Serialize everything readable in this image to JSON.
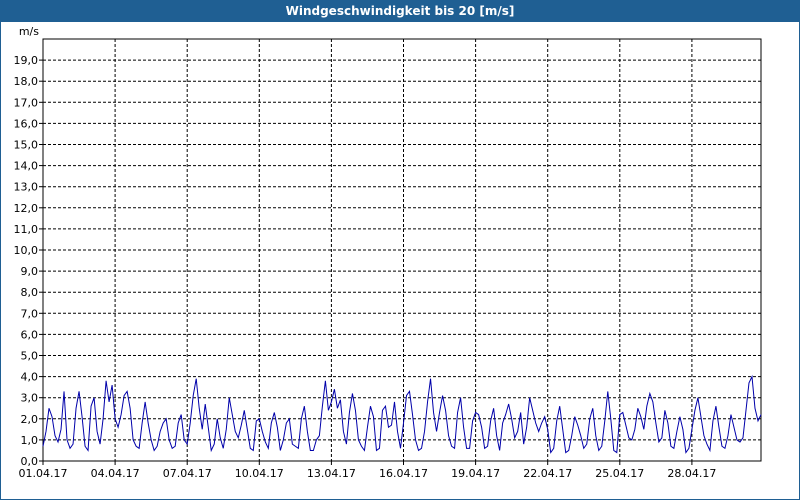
{
  "window": {
    "title": "Windgeschwindigkeit bis 20 [m/s]"
  },
  "chart_data": {
    "type": "line",
    "title": "Windgeschwindigkeit bis 20 [m/s]",
    "ylabel": "m/s",
    "ylim": [
      0,
      20
    ],
    "xlim": [
      "2017-04-01T00:00",
      "2017-04-30T21:00"
    ],
    "grid": true,
    "line_color": "#0000aa",
    "y_ticks": [
      "0,0",
      "1,0",
      "2,0",
      "3,0",
      "4,0",
      "5,0",
      "6,0",
      "7,0",
      "8,0",
      "9,0",
      "10,0",
      "11,0",
      "12,0",
      "13,0",
      "14,0",
      "15,0",
      "16,0",
      "17,0",
      "18,0",
      "19,0"
    ],
    "x_ticks": [
      "01.04.17",
      "04.04.17",
      "07.04.17",
      "10.04.17",
      "13.04.17",
      "16.04.17",
      "19.04.17",
      "22.04.17",
      "25.04.17",
      "28.04.17"
    ],
    "series": [
      {
        "start": "2017-04-01T00:00",
        "interval_hours": 3,
        "values": [
          0.7,
          1.4,
          2.5,
          2.1,
          1.2,
          0.9,
          1.5,
          3.3,
          1.0,
          0.6,
          0.8,
          2.5,
          3.3,
          2.1,
          0.7,
          0.5,
          2.6,
          3.0,
          1.4,
          0.8,
          2.0,
          3.8,
          2.8,
          3.6,
          2.0,
          1.6,
          2.2,
          3.1,
          3.3,
          2.5,
          1.0,
          0.7,
          0.6,
          1.8,
          2.8,
          1.8,
          1.0,
          0.5,
          0.7,
          1.4,
          1.8,
          2.0,
          1.0,
          0.6,
          0.7,
          1.8,
          2.2,
          1.0,
          0.8,
          1.8,
          3.1,
          3.9,
          2.5,
          1.5,
          2.7,
          1.6,
          0.5,
          0.8,
          2.0,
          1.1,
          0.6,
          1.5,
          3.0,
          2.2,
          1.4,
          1.1,
          1.7,
          2.4,
          1.5,
          0.6,
          0.5,
          1.9,
          2.0,
          1.4,
          0.9,
          0.6,
          1.8,
          2.3,
          1.6,
          0.5,
          1.0,
          1.8,
          2.0,
          0.8,
          0.7,
          0.6,
          2.0,
          2.6,
          1.4,
          0.5,
          0.5,
          1.0,
          1.2,
          2.6,
          3.8,
          2.4,
          2.8,
          3.4,
          2.5,
          2.9,
          1.4,
          0.8,
          2.3,
          3.2,
          2.4,
          1.0,
          0.7,
          0.5,
          1.6,
          2.6,
          2.1,
          0.5,
          0.6,
          2.4,
          2.6,
          1.6,
          1.7,
          2.8,
          1.4,
          0.6,
          1.8,
          3.1,
          3.3,
          2.2,
          1.0,
          0.5,
          0.6,
          1.4,
          2.8,
          3.9,
          2.3,
          1.4,
          2.3,
          3.1,
          2.4,
          1.2,
          0.7,
          0.6,
          2.3,
          3.0,
          1.6,
          0.6,
          0.6,
          1.9,
          2.3,
          2.2,
          1.6,
          0.6,
          0.7,
          1.9,
          2.5,
          1.2,
          0.5,
          1.8,
          2.2,
          2.7,
          2.0,
          1.1,
          1.4,
          2.3,
          0.8,
          1.6,
          3.0,
          2.4,
          1.8,
          1.4,
          1.8,
          2.1,
          1.5,
          0.4,
          0.6,
          1.9,
          2.6,
          1.5,
          0.4,
          0.5,
          1.2,
          2.1,
          1.7,
          1.2,
          0.6,
          0.8,
          2.0,
          2.5,
          1.2,
          0.5,
          0.7,
          1.9,
          3.3,
          2.0,
          0.5,
          0.4,
          2.2,
          2.3,
          1.7,
          1.1,
          1.0,
          1.5,
          2.5,
          2.1,
          1.5,
          2.6,
          3.2,
          2.8,
          1.8,
          0.9,
          1.1,
          2.4,
          1.8,
          0.7,
          0.6,
          1.4,
          2.1,
          1.5,
          0.4,
          0.6,
          1.5,
          2.4,
          3.0,
          2.1,
          1.2,
          0.8,
          0.5,
          1.9,
          2.6,
          1.6,
          0.7,
          0.6,
          1.2,
          2.2,
          1.6,
          1.0,
          0.9,
          1.1,
          2.4,
          3.7,
          4.0,
          2.5,
          1.9,
          2.2
        ]
      }
    ]
  }
}
